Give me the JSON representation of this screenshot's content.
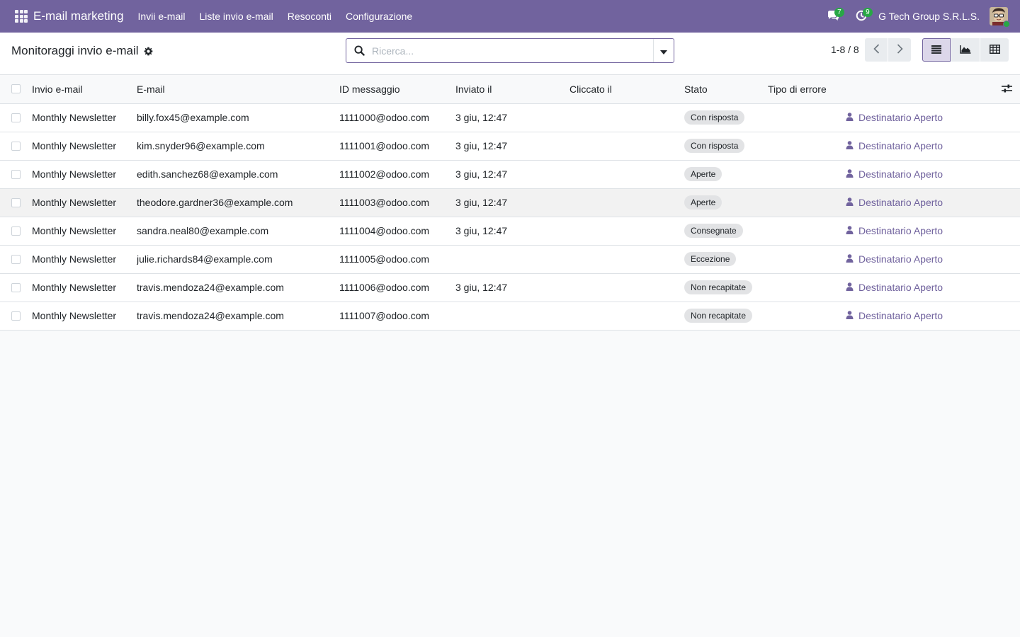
{
  "navbar": {
    "brand": "E-mail marketing",
    "menu": [
      "Invii e-mail",
      "Liste invio e-mail",
      "Resoconti",
      "Configurazione"
    ],
    "messages_count": "7",
    "activities_count": "9",
    "company": "G Tech Group S.R.L.S.",
    "color": "#71639e"
  },
  "control_panel": {
    "title": "Monitoraggi invio e-mail",
    "search_placeholder": "Ricerca...",
    "pager": "1-8 / 8"
  },
  "table": {
    "headers": [
      "Invio e-mail",
      "E-mail",
      "ID messaggio",
      "Inviato il",
      "Cliccato il",
      "Stato",
      "Tipo di errore"
    ],
    "rows": [
      {
        "mailing": "Monthly Newsletter",
        "email": "billy.fox45@example.com",
        "message_id": "1111000@odoo.com",
        "sent": "3 giu, 12:47",
        "clicked": "",
        "state": "Con risposta",
        "partner": "Destinatario Aperto"
      },
      {
        "mailing": "Monthly Newsletter",
        "email": "kim.snyder96@example.com",
        "message_id": "1111001@odoo.com",
        "sent": "3 giu, 12:47",
        "clicked": "",
        "state": "Con risposta",
        "partner": "Destinatario Aperto"
      },
      {
        "mailing": "Monthly Newsletter",
        "email": "edith.sanchez68@example.com",
        "message_id": "1111002@odoo.com",
        "sent": "3 giu, 12:47",
        "clicked": "",
        "state": "Aperte",
        "partner": "Destinatario Aperto"
      },
      {
        "mailing": "Monthly Newsletter",
        "email": "theodore.gardner36@example.com",
        "message_id": "1111003@odoo.com",
        "sent": "3 giu, 12:47",
        "clicked": "",
        "state": "Aperte",
        "partner": "Destinatario Aperto"
      },
      {
        "mailing": "Monthly Newsletter",
        "email": "sandra.neal80@example.com",
        "message_id": "1111004@odoo.com",
        "sent": "3 giu, 12:47",
        "clicked": "",
        "state": "Consegnate",
        "partner": "Destinatario Aperto"
      },
      {
        "mailing": "Monthly Newsletter",
        "email": "julie.richards84@example.com",
        "message_id": "1111005@odoo.com",
        "sent": "",
        "clicked": "",
        "state": "Eccezione",
        "partner": "Destinatario Aperto"
      },
      {
        "mailing": "Monthly Newsletter",
        "email": "travis.mendoza24@example.com",
        "message_id": "1111006@odoo.com",
        "sent": "3 giu, 12:47",
        "clicked": "",
        "state": "Non recapitate",
        "partner": "Destinatario Aperto"
      },
      {
        "mailing": "Monthly Newsletter",
        "email": "travis.mendoza24@example.com",
        "message_id": "1111007@odoo.com",
        "sent": "",
        "clicked": "",
        "state": "Non recapitate",
        "partner": "Destinatario Aperto"
      }
    ]
  }
}
